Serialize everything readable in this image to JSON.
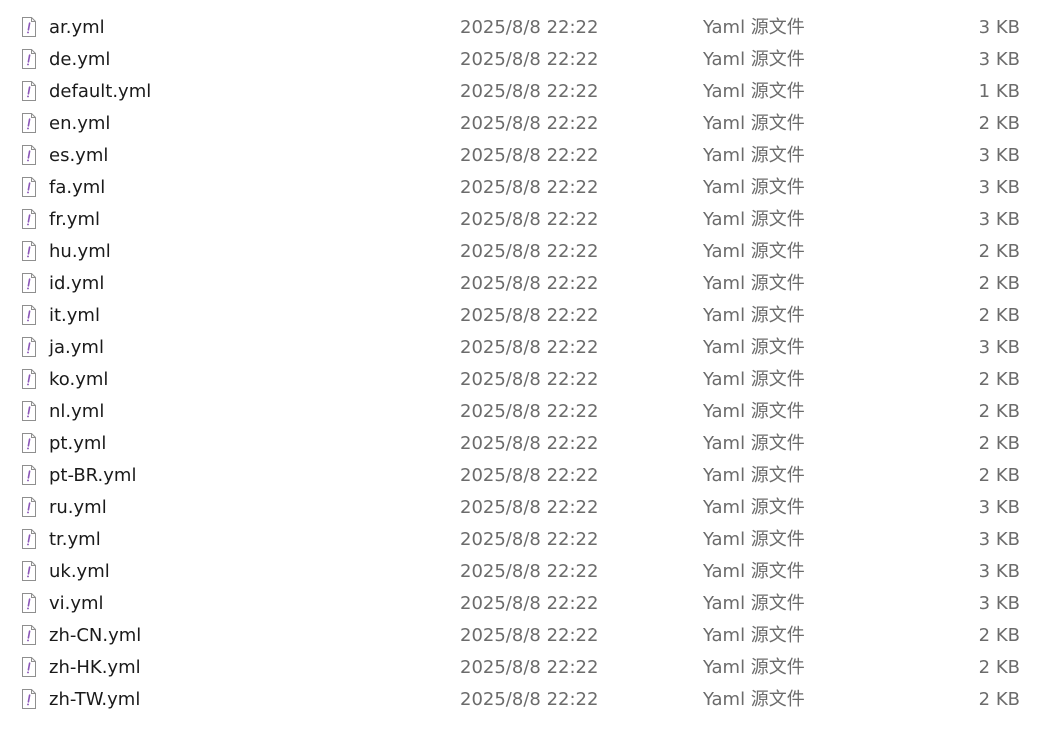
{
  "colors": {
    "name_text": "#1a1a1a",
    "meta_text": "#6b6b6b",
    "icon_stroke": "#8f8f8f",
    "icon_glyph": "#8b56b8"
  },
  "file_icon": "yaml-file-icon",
  "files": [
    {
      "name": "ar.yml",
      "date": "2025/8/8 22:22",
      "type": "Yaml 源文件",
      "size": "3 KB"
    },
    {
      "name": "de.yml",
      "date": "2025/8/8 22:22",
      "type": "Yaml 源文件",
      "size": "3 KB"
    },
    {
      "name": "default.yml",
      "date": "2025/8/8 22:22",
      "type": "Yaml 源文件",
      "size": "1 KB"
    },
    {
      "name": "en.yml",
      "date": "2025/8/8 22:22",
      "type": "Yaml 源文件",
      "size": "2 KB"
    },
    {
      "name": "es.yml",
      "date": "2025/8/8 22:22",
      "type": "Yaml 源文件",
      "size": "3 KB"
    },
    {
      "name": "fa.yml",
      "date": "2025/8/8 22:22",
      "type": "Yaml 源文件",
      "size": "3 KB"
    },
    {
      "name": "fr.yml",
      "date": "2025/8/8 22:22",
      "type": "Yaml 源文件",
      "size": "3 KB"
    },
    {
      "name": "hu.yml",
      "date": "2025/8/8 22:22",
      "type": "Yaml 源文件",
      "size": "2 KB"
    },
    {
      "name": "id.yml",
      "date": "2025/8/8 22:22",
      "type": "Yaml 源文件",
      "size": "2 KB"
    },
    {
      "name": "it.yml",
      "date": "2025/8/8 22:22",
      "type": "Yaml 源文件",
      "size": "2 KB"
    },
    {
      "name": "ja.yml",
      "date": "2025/8/8 22:22",
      "type": "Yaml 源文件",
      "size": "3 KB"
    },
    {
      "name": "ko.yml",
      "date": "2025/8/8 22:22",
      "type": "Yaml 源文件",
      "size": "2 KB"
    },
    {
      "name": "nl.yml",
      "date": "2025/8/8 22:22",
      "type": "Yaml 源文件",
      "size": "2 KB"
    },
    {
      "name": "pt.yml",
      "date": "2025/8/8 22:22",
      "type": "Yaml 源文件",
      "size": "2 KB"
    },
    {
      "name": "pt-BR.yml",
      "date": "2025/8/8 22:22",
      "type": "Yaml 源文件",
      "size": "2 KB"
    },
    {
      "name": "ru.yml",
      "date": "2025/8/8 22:22",
      "type": "Yaml 源文件",
      "size": "3 KB"
    },
    {
      "name": "tr.yml",
      "date": "2025/8/8 22:22",
      "type": "Yaml 源文件",
      "size": "3 KB"
    },
    {
      "name": "uk.yml",
      "date": "2025/8/8 22:22",
      "type": "Yaml 源文件",
      "size": "3 KB"
    },
    {
      "name": "vi.yml",
      "date": "2025/8/8 22:22",
      "type": "Yaml 源文件",
      "size": "3 KB"
    },
    {
      "name": "zh-CN.yml",
      "date": "2025/8/8 22:22",
      "type": "Yaml 源文件",
      "size": "2 KB"
    },
    {
      "name": "zh-HK.yml",
      "date": "2025/8/8 22:22",
      "type": "Yaml 源文件",
      "size": "2 KB"
    },
    {
      "name": "zh-TW.yml",
      "date": "2025/8/8 22:22",
      "type": "Yaml 源文件",
      "size": "2 KB"
    }
  ]
}
